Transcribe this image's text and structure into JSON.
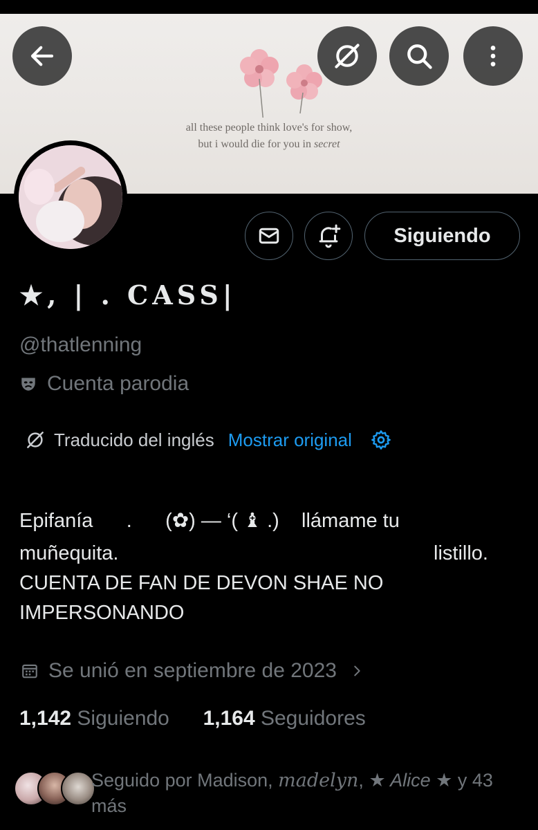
{
  "banner": {
    "quote_line1": "all these people think love's for show,",
    "quote_line2_prefix": "but i would die for you in ",
    "quote_line2_italic": "secret"
  },
  "topbar": {
    "back_icon": "arrow-left-icon",
    "translate_icon": "translate-icon",
    "search_icon": "search-icon",
    "more_icon": "more-vertical-icon"
  },
  "actions": {
    "message_icon": "envelope-icon",
    "notify_icon": "bell-plus-icon",
    "following_label": "Siguiendo"
  },
  "profile": {
    "display_name": "★, | . CASS|",
    "handle": "@thatlenning",
    "parody_label": "Cuenta parodia",
    "parody_icon": "mask-icon"
  },
  "translation": {
    "label": "Traducido del inglés",
    "show_original": "Mostrar original",
    "icon": "translate-icon",
    "settings_icon": "gear-icon"
  },
  "bio": {
    "line1": "Epifanía      .      (✿) — ‘( ♝ .)    llámame tu",
    "line2_left": "muñequita.",
    "line2_right": "listillo.",
    "line3": "CUENTA DE FAN DE DEVON SHAE NO",
    "line4": "IMPERSONANDO"
  },
  "joined": {
    "text": "Se unió en septiembre de 2023",
    "icon": "calendar-icon"
  },
  "stats": {
    "following_count": "1,142",
    "following_label": "Siguiendo",
    "followers_count": "1,164",
    "followers_label": "Seguidores"
  },
  "followed_by": {
    "prefix": "Seguido por Madison, ",
    "name2": "madelyn",
    "sep": ", ",
    "name3": "★ Alice ★",
    "suffix": " y 43",
    "line2": "más"
  },
  "colors": {
    "background": "#000000",
    "text_primary": "#e7e9ea",
    "text_secondary": "#71767b",
    "link": "#1d9bf0",
    "border": "#536471"
  }
}
